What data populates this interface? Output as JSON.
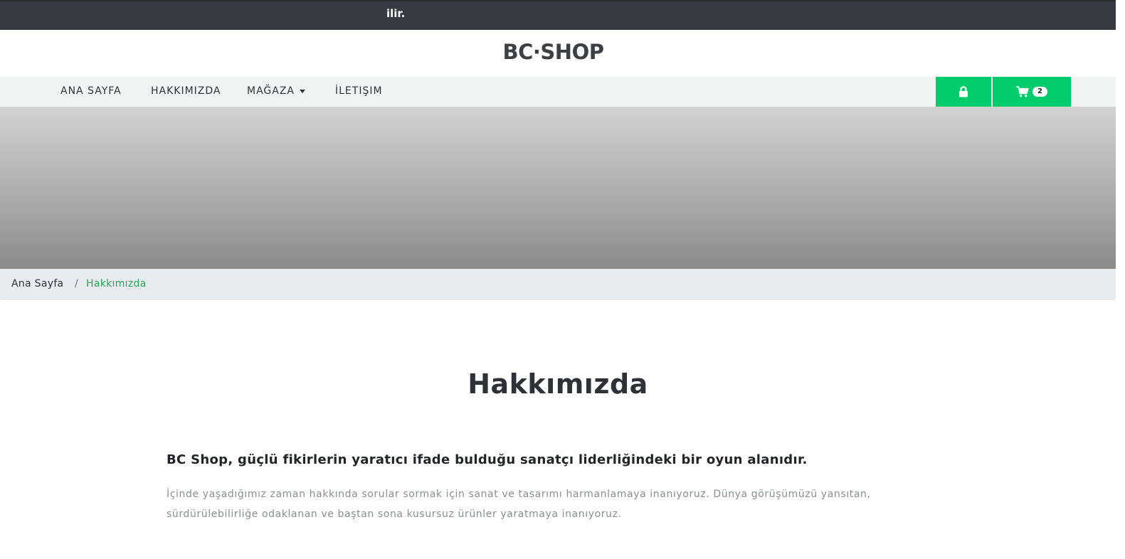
{
  "topbar": {
    "ticker_text": "ilir."
  },
  "brand": {
    "name": "BC·SHOP"
  },
  "nav": {
    "items": [
      {
        "label": "ANA SAYFA"
      },
      {
        "label": "HAKKIMIZDA"
      },
      {
        "label": "MAĞAZA",
        "has_dropdown": true
      },
      {
        "label": "İLETIŞIM"
      }
    ],
    "cart_count": "2",
    "lock_icon": "lock-icon",
    "cart_icon": "cart-icon"
  },
  "breadcrumb": {
    "home": "Ana Sayfa",
    "separator": "/",
    "current": "Hakkımızda"
  },
  "content": {
    "title": "Hakkımızda",
    "headline": "BC Shop, güçlü fikirlerin yaratıcı ifade bulduğu sanatçı liderliğindeki bir oyun alanıdır.",
    "body": "İçinde yaşadığımız zaman hakkında sorular sormak için sanat ve tasarımı harmanlamaya inanıyoruz. Dünya görüşümüzü yansıtan, sürdürülebilirliğe odaklanan ve baştan sona kusursuz ürünler yaratmaya inanıyoruz."
  },
  "colors": {
    "accent": "#03cc6d",
    "breadcrumb_active": "#26a65b",
    "topbar": "#373a40"
  }
}
